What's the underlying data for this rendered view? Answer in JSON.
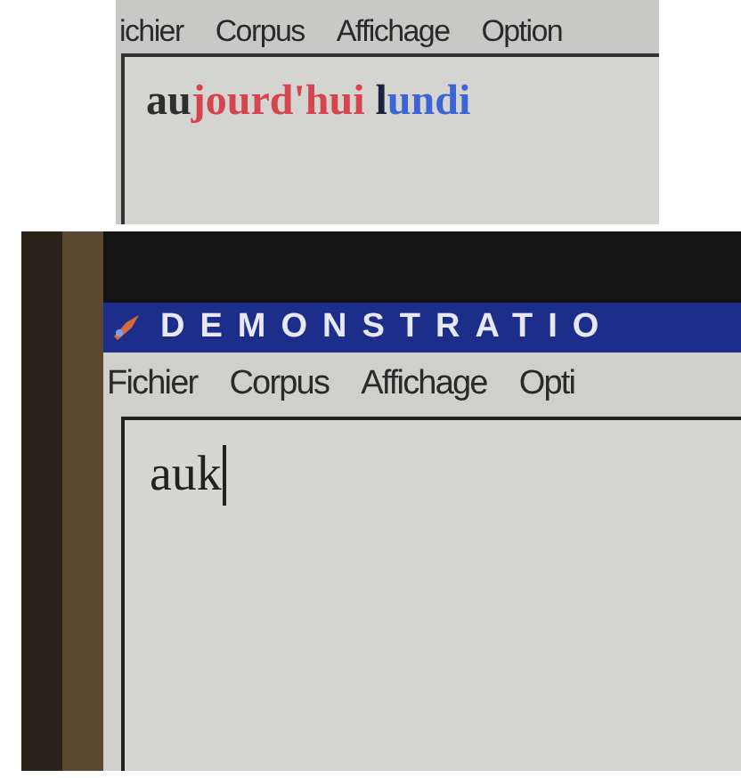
{
  "top_window": {
    "menu": [
      {
        "label": "ichier"
      },
      {
        "label": "Corpus"
      },
      {
        "label": "Affichage"
      },
      {
        "label": "Option"
      }
    ],
    "editor": {
      "words": [
        {
          "parts": [
            {
              "text": "au",
              "color": "#2e2e2e"
            },
            {
              "text": "jourd'hui",
              "color": "#d64450"
            }
          ]
        },
        {
          "parts": [
            {
              "text": "l",
              "color": "#1e2240"
            },
            {
              "text": "undi",
              "color": "#3c64d4"
            }
          ]
        }
      ]
    }
  },
  "bottom_window": {
    "title": "DEMONSTRATIO",
    "menu": [
      {
        "label": "Fichier"
      },
      {
        "label": "Corpus"
      },
      {
        "label": "Affichage"
      },
      {
        "label": "Opti"
      }
    ],
    "editor": {
      "value": "auk"
    }
  }
}
